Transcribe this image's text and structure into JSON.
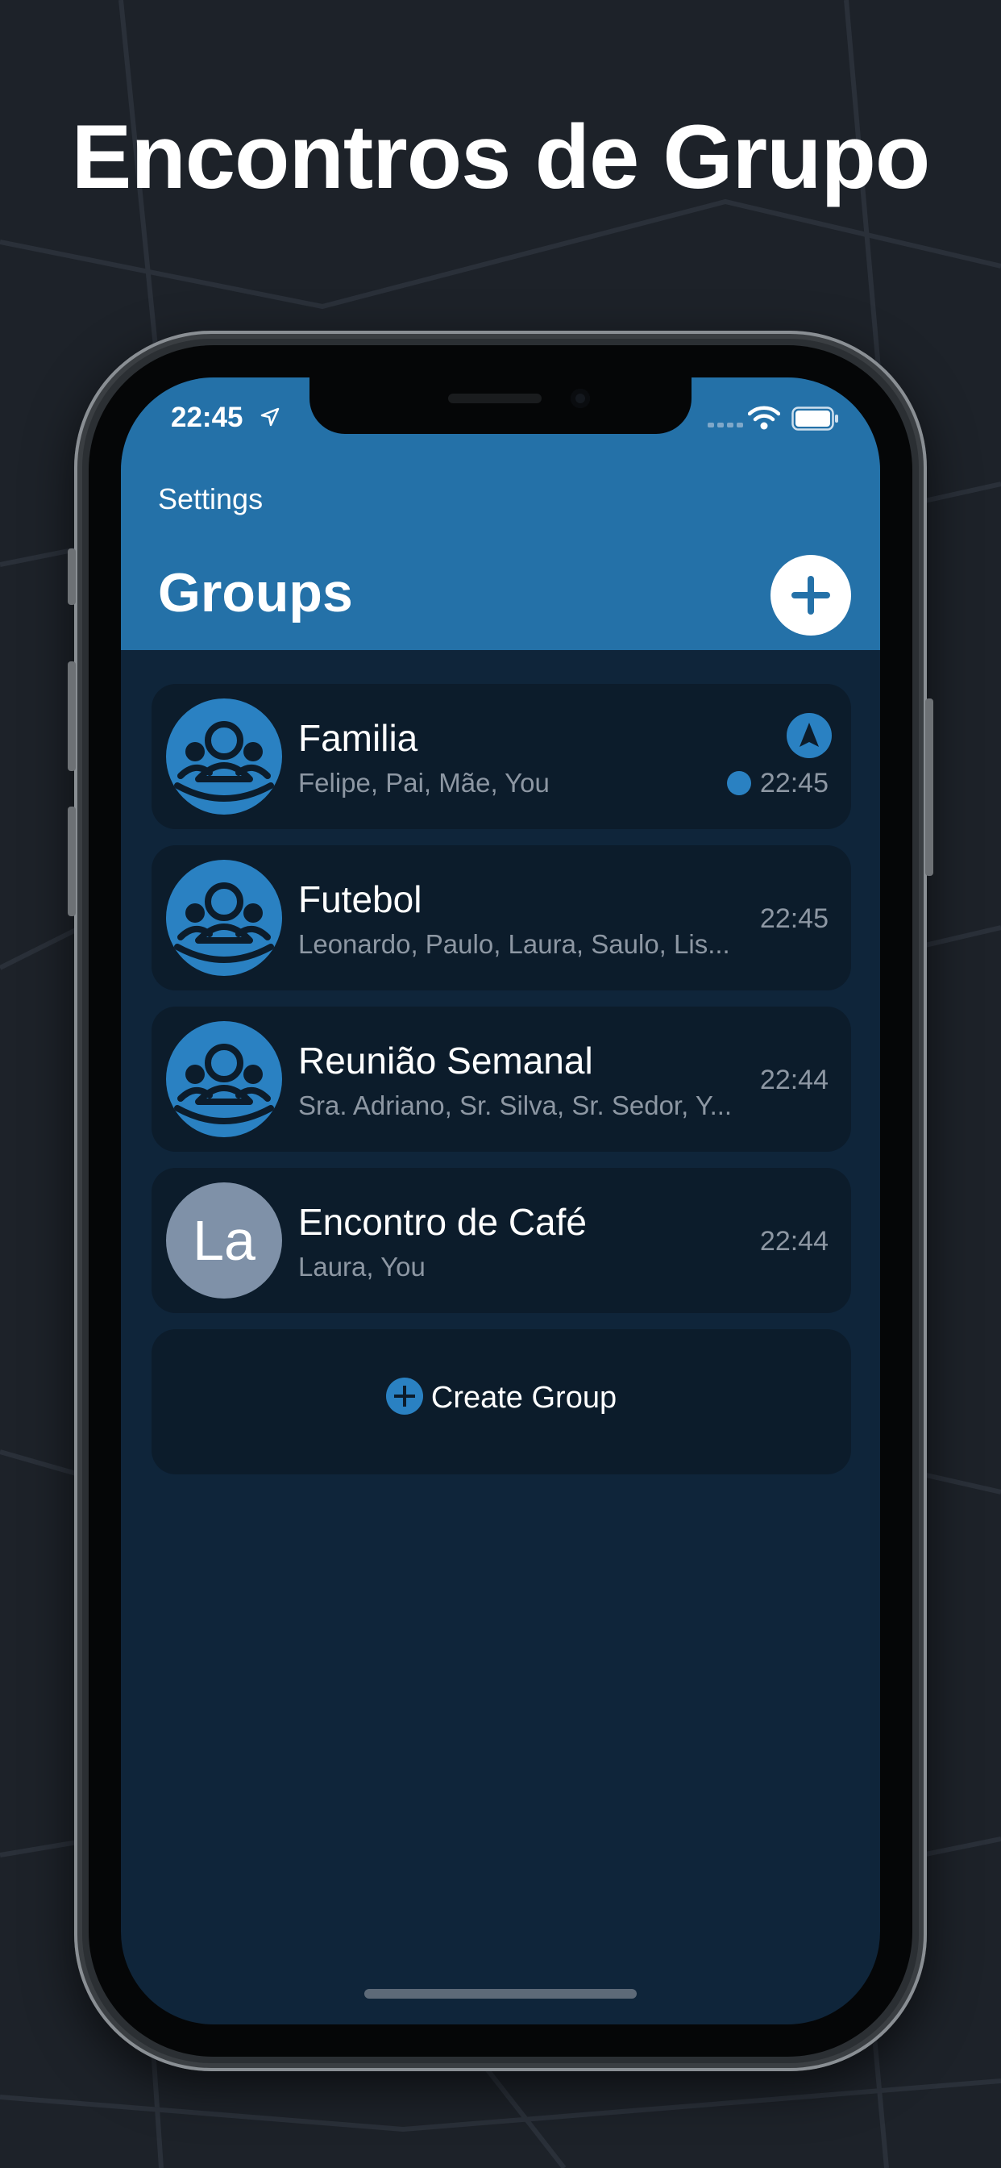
{
  "headline": "Encontros de Grupo",
  "status_bar": {
    "time": "22:45",
    "icons": [
      "location-arrow-icon",
      "signal-dots-icon",
      "wifi-icon",
      "battery-icon"
    ]
  },
  "nav": {
    "settings_label": "Settings",
    "title": "Groups",
    "add_icon": "plus-icon"
  },
  "groups": [
    {
      "name": "Familia",
      "members": "Felipe, Pai, Mãe, You",
      "time": "22:45",
      "avatar": "group-icon",
      "navigation_active": true,
      "live": true
    },
    {
      "name": "Futebol",
      "members": "Leonardo, Paulo, Laura, Saulo, Lis...",
      "time": "22:45",
      "avatar": "group-icon"
    },
    {
      "name": "Reunião Semanal",
      "members": "Sra. Adriano, Sr. Silva, Sr. Sedor, Y...",
      "time": "22:44",
      "avatar": "group-icon"
    },
    {
      "name": "Encontro de Café",
      "members": "Laura, You",
      "time": "22:44",
      "avatar_initials": "La"
    }
  ],
  "create_group_label": "Create Group",
  "colors": {
    "accent": "#2a81c2",
    "header": "#2471a8",
    "screen_bg": "#0f253a",
    "card_bg": "#0c1c2b",
    "page_bg": "#1d2229",
    "muted_text": "#8d97a3"
  }
}
